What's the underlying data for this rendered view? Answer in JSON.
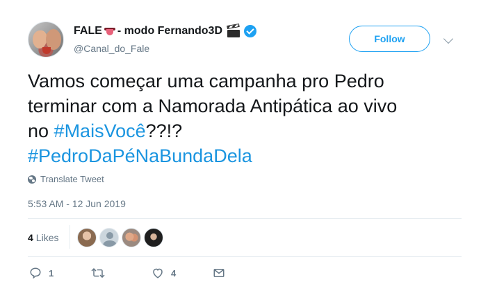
{
  "tweet": {
    "author": {
      "display_name_part1": "FALE",
      "display_name_part2": "- modo Fernando3D",
      "handle": "@Canal_do_Fale",
      "emoji_1": "tongue-emoji",
      "emoji_2": "clapper-board-emoji",
      "verified": true
    },
    "follow_label": "Follow",
    "text_line1": "Vamos começar uma campanha pro Pedro",
    "text_line2": "terminar com a Namorada Antipática ao vivo",
    "text_line3_prefix": "no ",
    "hashtag_1": "#MaisVocê",
    "text_line3_suffix": "??!?",
    "hashtag_2": "#PedroDaPéNaBundaDela",
    "translate_label": "Translate Tweet",
    "timestamp": "5:53 AM - 12 Jun 2019",
    "likes_count": "4",
    "likes_label": "Likes",
    "actions": {
      "reply_count": "1",
      "retweet_count": "",
      "like_count": "4"
    },
    "colors": {
      "accent": "#1da1f2",
      "hashtag": "#1b95e0",
      "secondary_text": "#657786",
      "divider": "#e6ecf0"
    }
  }
}
